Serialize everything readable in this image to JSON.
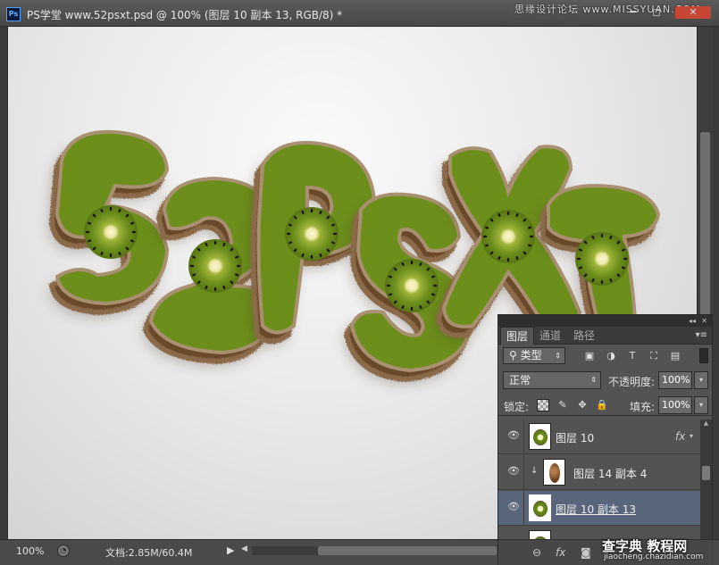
{
  "app": {
    "logo_text": "Ps",
    "document_title": "PS学堂 www.52psxt.psd @ 100% (图层 10 副本 13, RGB/8) *",
    "window_controls": {
      "minimize": "━",
      "maximize": "◻",
      "close": "✕"
    },
    "watermark_top": "思缘设计论坛 www.MISSYUAN.COM"
  },
  "canvas": {
    "artwork_label": "52psxt",
    "artwork_description_icon": "kiwi-text-artwork"
  },
  "statusbar": {
    "zoom": "100%",
    "doc_info": "文档:2.85M/60.4M",
    "arrow": "▶",
    "scroll_left": "◀"
  },
  "layers_panel": {
    "collapse": "◂◂",
    "close": "✕",
    "tabs": [
      {
        "label": "图层",
        "active": true
      },
      {
        "label": "通道",
        "active": false
      },
      {
        "label": "路径",
        "active": false
      }
    ],
    "menu": "▾≡",
    "filter": {
      "search_glyph": "⚲",
      "label": "类型",
      "chevron": "⇕"
    },
    "filter_icons": {
      "pixel": "▣",
      "adjustment": "◑",
      "type": "T",
      "shape": "⛶",
      "smart": "▤"
    },
    "blend_mode": {
      "label": "正常",
      "chevron": "⇕"
    },
    "opacity": {
      "label": "不透明度:",
      "value": "100%",
      "dropdown": "▾"
    },
    "lock": {
      "label": "锁定:",
      "brush": "✎",
      "move": "✥",
      "lock": "🔒"
    },
    "fill": {
      "label": "填充:",
      "value": "100%",
      "dropdown": "▾"
    },
    "layers": [
      {
        "name": "图层 10",
        "visible": true,
        "has_fx": true,
        "fx": "fx",
        "fx_toggle": "▾",
        "clipped": false,
        "selected": false,
        "thumb": "kiwi"
      },
      {
        "name": "图层 14 副本 4",
        "visible": true,
        "has_fx": false,
        "clipped": true,
        "clip_glyph": "↓",
        "selected": false,
        "thumb": "brown"
      },
      {
        "name": "图层 10 副本 13",
        "visible": true,
        "has_fx": false,
        "clipped": false,
        "selected": true,
        "thumb": "kiwi"
      }
    ],
    "eye_glyph": "👁",
    "footer": {
      "link": "⊖",
      "fx": "fx",
      "mask": "◙"
    }
  },
  "watermark_bottom": {
    "main": "查字典 教程网",
    "sub": "jiaocheng.chazidian.com"
  },
  "colors": {
    "selected_row": "#58657a",
    "close_button": "#c64535",
    "kiwi_green": "#6a8e1a",
    "kiwi_skin": "#6b4a2a"
  }
}
